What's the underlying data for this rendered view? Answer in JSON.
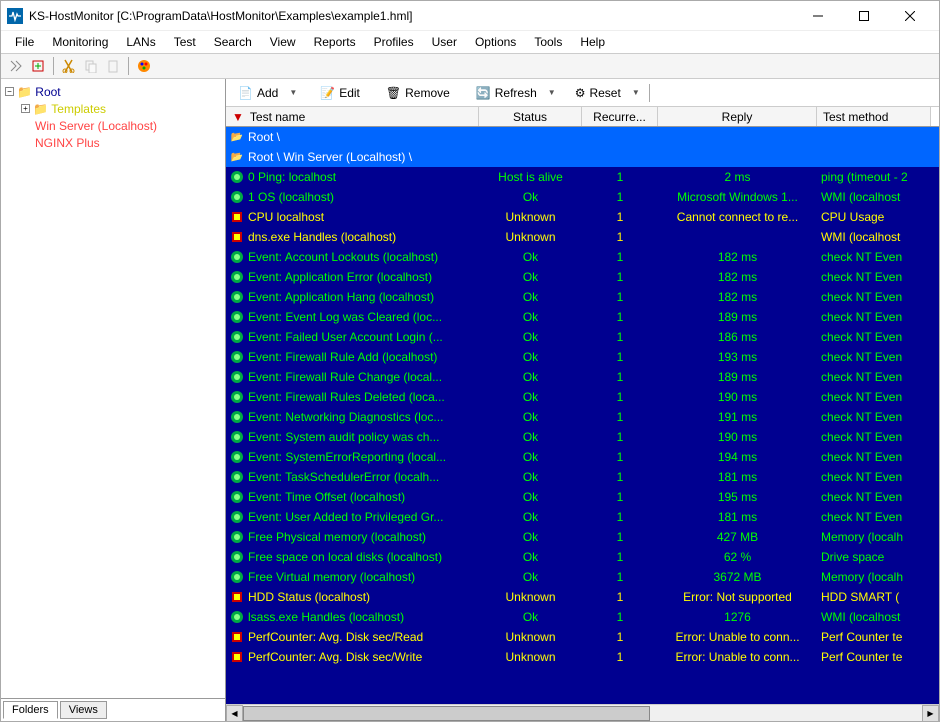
{
  "title": "KS-HostMonitor  [C:\\ProgramData\\HostMonitor\\Examples\\example1.hml]",
  "menu": [
    "File",
    "Monitoring",
    "LANs",
    "Test",
    "Search",
    "View",
    "Reports",
    "Profiles",
    "User",
    "Options",
    "Tools",
    "Help"
  ],
  "toolbar": {
    "add": "Add",
    "edit": "Edit",
    "remove": "Remove",
    "refresh": "Refresh",
    "reset": "Reset"
  },
  "tree": {
    "root": "Root",
    "templates": "Templates",
    "winserver": "Win Server (Localhost)",
    "nginx": "NGINX Plus"
  },
  "tabs": {
    "folders": "Folders",
    "views": "Views"
  },
  "columns": {
    "name": "Test name",
    "status": "Status",
    "rec": "Recurre...",
    "reply": "Reply",
    "method": "Test method"
  },
  "rows": [
    {
      "type": "folder",
      "name": "Root \\"
    },
    {
      "type": "folder",
      "name": "Root \\ Win Server (Localhost) \\"
    },
    {
      "type": "ok",
      "icon": "ping",
      "name": "0 Ping: localhost",
      "status": "Host is alive",
      "rec": "1",
      "reply": "2 ms",
      "method": "ping (timeout - 2"
    },
    {
      "type": "ok",
      "icon": "ok",
      "name": "1 OS (localhost)",
      "status": "Ok",
      "rec": "1",
      "reply": "Microsoft Windows 1...",
      "method": "WMI (localhost"
    },
    {
      "type": "unknown",
      "icon": "warn",
      "name": "CPU localhost",
      "status": "Unknown",
      "rec": "1",
      "reply": "Cannot connect to re...",
      "method": "CPU Usage"
    },
    {
      "type": "unknown",
      "icon": "warn",
      "name": "dns.exe Handles (localhost)",
      "status": "Unknown",
      "rec": "1",
      "reply": "",
      "method": "WMI (localhost"
    },
    {
      "type": "ok",
      "icon": "ok",
      "name": "Event: Account Lockouts (localhost)",
      "status": "Ok",
      "rec": "1",
      "reply": "182 ms",
      "method": "check NT Even"
    },
    {
      "type": "ok",
      "icon": "ok",
      "name": "Event: Application Error (localhost)",
      "status": "Ok",
      "rec": "1",
      "reply": "182 ms",
      "method": "check NT Even"
    },
    {
      "type": "ok",
      "icon": "ok",
      "name": "Event: Application Hang (localhost)",
      "status": "Ok",
      "rec": "1",
      "reply": "182 ms",
      "method": "check NT Even"
    },
    {
      "type": "ok",
      "icon": "ok",
      "name": "Event: Event Log was Cleared (loc...",
      "status": "Ok",
      "rec": "1",
      "reply": "189 ms",
      "method": "check NT Even"
    },
    {
      "type": "ok",
      "icon": "ok",
      "name": "Event: Failed User Account Login (...",
      "status": "Ok",
      "rec": "1",
      "reply": "186 ms",
      "method": "check NT Even"
    },
    {
      "type": "ok",
      "icon": "ok",
      "name": "Event: Firewall Rule Add (localhost)",
      "status": "Ok",
      "rec": "1",
      "reply": "193 ms",
      "method": "check NT Even"
    },
    {
      "type": "ok",
      "icon": "ok",
      "name": "Event: Firewall Rule Change (local...",
      "status": "Ok",
      "rec": "1",
      "reply": "189 ms",
      "method": "check NT Even"
    },
    {
      "type": "ok",
      "icon": "ok",
      "name": "Event: Firewall Rules Deleted (loca...",
      "status": "Ok",
      "rec": "1",
      "reply": "190 ms",
      "method": "check NT Even"
    },
    {
      "type": "ok",
      "icon": "ok",
      "name": "Event: Networking Diagnostics (loc...",
      "status": "Ok",
      "rec": "1",
      "reply": "191 ms",
      "method": "check NT Even"
    },
    {
      "type": "ok",
      "icon": "ok",
      "name": "Event: System audit policy was ch...",
      "status": "Ok",
      "rec": "1",
      "reply": "190 ms",
      "method": "check NT Even"
    },
    {
      "type": "ok",
      "icon": "ok",
      "name": "Event: SystemErrorReporting (local...",
      "status": "Ok",
      "rec": "1",
      "reply": "194 ms",
      "method": "check NT Even"
    },
    {
      "type": "ok",
      "icon": "ok",
      "name": "Event: TaskSchedulerError (localh...",
      "status": "Ok",
      "rec": "1",
      "reply": "181 ms",
      "method": "check NT Even"
    },
    {
      "type": "ok",
      "icon": "ok",
      "name": "Event: Time Offset (localhost)",
      "status": "Ok",
      "rec": "1",
      "reply": "195 ms",
      "method": "check NT Even"
    },
    {
      "type": "ok",
      "icon": "ok",
      "name": "Event: User Added to Privileged Gr...",
      "status": "Ok",
      "rec": "1",
      "reply": "181 ms",
      "method": "check NT Even"
    },
    {
      "type": "ok",
      "icon": "ok",
      "name": "Free Physical memory (localhost)",
      "status": "Ok",
      "rec": "1",
      "reply": "427 MB",
      "method": "Memory (localh"
    },
    {
      "type": "ok",
      "icon": "ok",
      "name": "Free space on local disks (localhost)",
      "status": "Ok",
      "rec": "1",
      "reply": "62 %",
      "method": "Drive space"
    },
    {
      "type": "ok",
      "icon": "ok",
      "name": "Free Virtual memory (localhost)",
      "status": "Ok",
      "rec": "1",
      "reply": "3672 MB",
      "method": "Memory (localh"
    },
    {
      "type": "unknown",
      "icon": "warn",
      "name": "HDD Status (localhost)",
      "status": "Unknown",
      "rec": "1",
      "reply": "Error: Not supported",
      "method": "HDD SMART ("
    },
    {
      "type": "ok",
      "icon": "ok",
      "name": "lsass.exe Handles (localhost)",
      "status": "Ok",
      "rec": "1",
      "reply": "1276",
      "method": "WMI (localhost"
    },
    {
      "type": "unknown",
      "icon": "warn",
      "name": "PerfCounter: Avg. Disk sec/Read",
      "status": "Unknown",
      "rec": "1",
      "reply": "Error: Unable to conn...",
      "method": "Perf Counter te"
    },
    {
      "type": "unknown",
      "icon": "warn",
      "name": "PerfCounter: Avg. Disk sec/Write",
      "status": "Unknown",
      "rec": "1",
      "reply": "Error: Unable to conn...",
      "method": "Perf Counter te"
    }
  ]
}
